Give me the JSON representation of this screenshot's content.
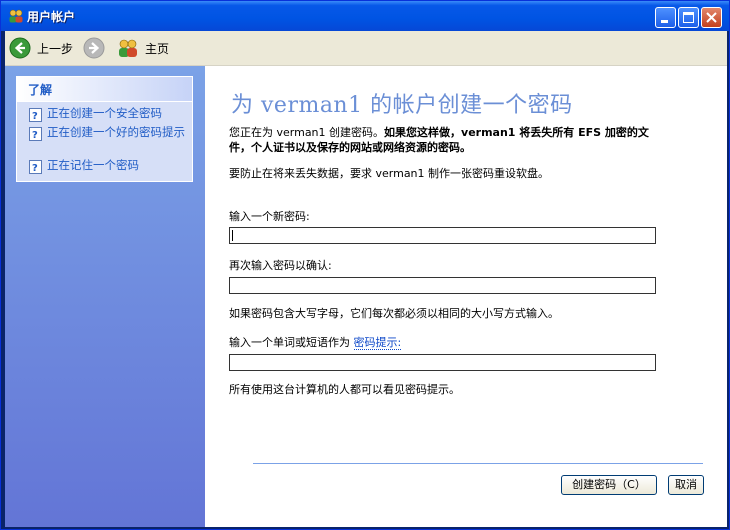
{
  "window": {
    "title": "用户帐户",
    "icon": "user-accounts-icon",
    "controls": [
      "minimize-icon",
      "maximize-icon",
      "close-icon"
    ]
  },
  "toolbar": {
    "back_label": "上一步",
    "forward_icon": "forward-arrow-icon",
    "home_label": "主页"
  },
  "sidebar": {
    "panel_title": "了解",
    "links": [
      "正在创建一个安全密码",
      "正在创建一个好的密码提示",
      "正在记住一个密码"
    ]
  },
  "main": {
    "heading": "为 verman1 的帐户创建一个密码",
    "intro_normal": "您正在为 verman1 创建密码。",
    "intro_bold": "如果您这样做，verman1 将丢失所有 EFS 加密的文件，个人证书以及保存的网站或网络资源的密码。",
    "reset_note": "要防止在将来丢失数据，要求 verman1 制作一张密码重设软盘。",
    "new_password_label": "输入一个新密码:",
    "new_password_value": "",
    "confirm_label": "再次输入密码以确认:",
    "confirm_value": "",
    "case_note": "如果密码包含大写字母，它们每次都必须以相同的大小写方式输入。",
    "hint_label_prefix": "输入一个单词或短语作为",
    "hint_link": "密码提示:",
    "hint_value": "",
    "hint_visibility_note": "所有使用这台计算机的人都可以看见密码提示。",
    "create_button": "创建密码（C）",
    "cancel_button": "取消"
  },
  "colors": {
    "title_bar": "#0054e3",
    "sidebar_top": "#7ba2e7",
    "sidebar_bottom": "#6375d6",
    "heading": "#6b8fd6",
    "link": "#215dc6"
  }
}
